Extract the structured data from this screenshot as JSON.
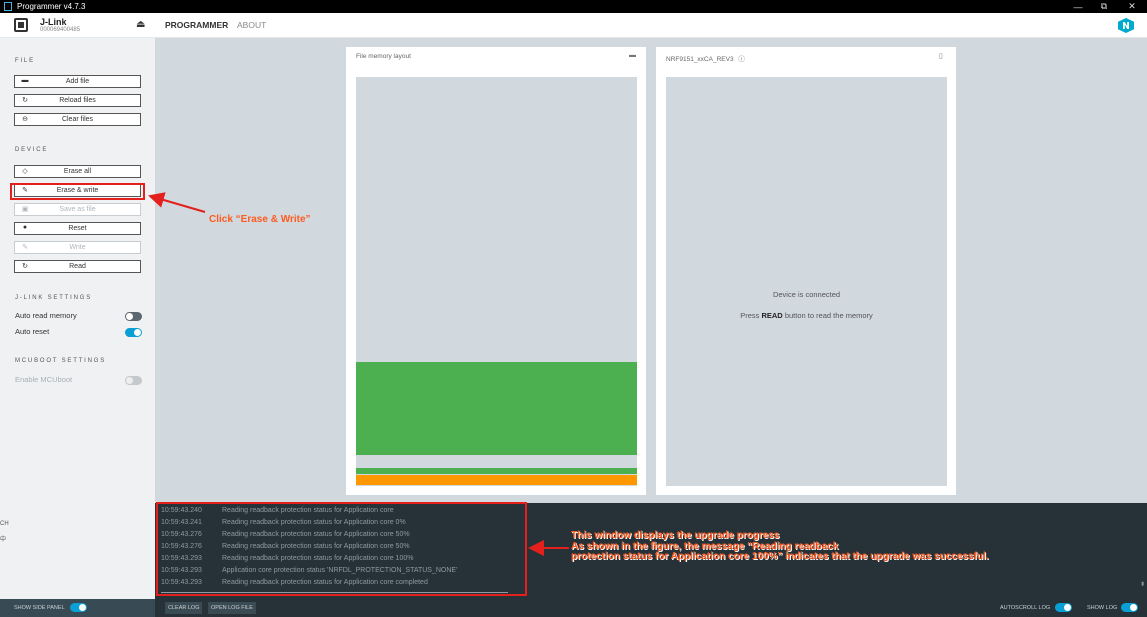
{
  "window": {
    "title": "Programmer v4.7.3",
    "minimize": "—",
    "maximize": "⧉",
    "close": "✕"
  },
  "header": {
    "device_name": "J-Link",
    "device_serial": "000069400485",
    "tabs": [
      "PROGRAMMER",
      "ABOUT"
    ]
  },
  "sidebar": {
    "file_title": "FILE",
    "file_buttons": [
      "Add file",
      "Reload files",
      "Clear files"
    ],
    "device_title": "DEVICE",
    "device_buttons": [
      "Erase all",
      "Erase & write",
      "Save as file",
      "Reset",
      "Write",
      "Read"
    ],
    "jlink_title": "J-LINK SETTINGS",
    "auto_read_memory": {
      "label": "Auto read memory",
      "on": false
    },
    "auto_reset": {
      "label": "Auto reset",
      "on": true
    },
    "mcuboot_title": "MCUBOOT SETTINGS",
    "enable_mcuboot": {
      "label": "Enable MCUboot",
      "on": false,
      "disabled": true
    },
    "edge_labels": [
      "CH",
      "中"
    ]
  },
  "cards": {
    "file_title": "File memory layout",
    "device_title": "NRF9151_xxCA_REV3",
    "device_connected": "Device is connected",
    "device_hint_pre": "Press ",
    "device_hint_bold": "READ",
    "device_hint_post": " button to read the memory"
  },
  "log": {
    "lines": [
      {
        "time": "10:59:43.240",
        "text": "Reading readback protection status for Application core"
      },
      {
        "time": "10:59:43.241",
        "text": "Reading readback protection status for Application core 0%"
      },
      {
        "time": "10:59:43.276",
        "text": "Reading readback protection status for Application core 50%"
      },
      {
        "time": "10:59:43.276",
        "text": "Reading readback protection status for Application core 50%"
      },
      {
        "time": "10:59:43.293",
        "text": "Reading readback protection status for Application core 100%"
      },
      {
        "time": "10:59:43.293",
        "text": "Application core protection status 'NRFDL_PROTECTION_STATUS_NONE'"
      },
      {
        "time": "10:59:43.293",
        "text": "Reading readback protection status for Application core completed"
      }
    ]
  },
  "bottom": {
    "show_side_panel": "SHOW SIDE PANEL",
    "clear_log": "CLEAR LOG",
    "open_log_file": "OPEN LOG FILE",
    "autoscroll_log": "AUTOSCROLL LOG",
    "show_log": "SHOW LOG"
  },
  "annotations": {
    "click_text": "Click “Erase & Write”",
    "log_note": [
      "This window displays the upgrade progress",
      "As shown in the figure, the message “Reading readback",
      "protection status for Application core 100%” indicates that the upgrade was successful."
    ],
    "color": "#e3201b"
  },
  "colors": {
    "accent": "#0a9fd5",
    "green": "#4caf50",
    "orange": "#ff9800",
    "log_bg": "#263238"
  }
}
